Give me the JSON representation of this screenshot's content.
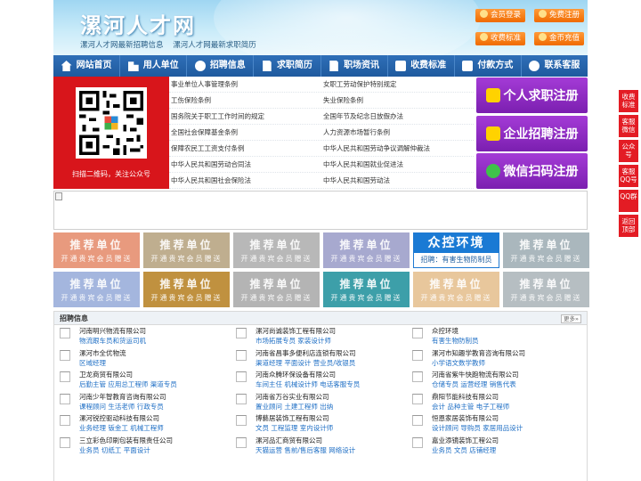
{
  "header": {
    "title": "漯河人才网",
    "slogans": [
      "漯河人才网最新招聘信息",
      "漯河人才网最新求职简历"
    ],
    "buttons": {
      "login": "会员登录",
      "register": "免费注册",
      "fees": "收费标准",
      "coins": "金币充值"
    }
  },
  "nav": [
    {
      "label": "网站首页",
      "icon": "home-icon"
    },
    {
      "label": "用人单位",
      "icon": "building-icon"
    },
    {
      "label": "招聘信息",
      "icon": "user-icon"
    },
    {
      "label": "求职简历",
      "icon": "document-icon"
    },
    {
      "label": "职场资讯",
      "icon": "news-icon"
    },
    {
      "label": "收费标准",
      "icon": "fee-icon"
    },
    {
      "label": "付款方式",
      "icon": "payment-icon"
    },
    {
      "label": "联系客服",
      "icon": "phone-icon"
    }
  ],
  "qr": {
    "caption": "扫描二维码，关注公众号"
  },
  "policies": [
    [
      "事业单位人事管理条例",
      "女职工劳动保护特别规定"
    ],
    [
      "工伤保险条例",
      "失业保险条例"
    ],
    [
      "国务院关于职工工作时间的规定",
      "全国年节及纪念日放假办法"
    ],
    [
      "全国社会保障基金条例",
      "人力资源市场暂行条例"
    ],
    [
      "保障农民工工资支付条例",
      "中华人民共和国劳动争议调解仲裁法"
    ],
    [
      "中华人民共和国劳动合同法",
      "中华人民共和国就业促进法"
    ],
    [
      "中华人民共和国社会保险法",
      "中华人民共和国劳动法"
    ]
  ],
  "register": {
    "job_seeker": "个人求职注册",
    "employer": "企业招聘注册",
    "wechat": "微信扫码注册"
  },
  "recommend": {
    "title": "推荐单位",
    "subtitle": "开通贵宾会员赠送",
    "brand_name": "众控环境",
    "brand_sub": "招聘：有害生物防制员",
    "colors": [
      "#e89a7e",
      "#bfae8f",
      "#b8b8b8",
      "#a7a9cf",
      "#1a7ad4",
      "#aab7bd",
      "#a4b6de",
      "#c0913f",
      "#b4b4b4",
      "#3d9fa9",
      "#e8c79c",
      "#b6bec2"
    ]
  },
  "jobs": {
    "title": "招聘信息",
    "more": "更多»",
    "items": [
      {
        "company": "河南明兴物流有限公司",
        "positions": "物流跟车员和货运司机"
      },
      {
        "company": "漯河尚诚装饰工程有限公司",
        "positions": "市场拓展专员 家装设计师"
      },
      {
        "company": "众控环境",
        "positions": "有害生物防制员"
      },
      {
        "company": "漯河市全优物流",
        "positions": "区域经理"
      },
      {
        "company": "河南省昌事多便利店连锁有限公司",
        "positions": "渠道经理 平面设计 营业员/收银员"
      },
      {
        "company": "漯河市知趣学教育咨询有限公司",
        "positions": "小学语文数学教师"
      },
      {
        "company": "卫龙商贸有限公司",
        "positions": "后勤主管 应用总工程师 渠道专员"
      },
      {
        "company": "河南众腾环保设备有限公司",
        "positions": "车间主任 机械设计师 电话客服专员"
      },
      {
        "company": "河南省紫牛快跑物流有限公司",
        "positions": "仓储专员 运营经理 销售代表"
      },
      {
        "company": "河南少年智教育咨询有限公司",
        "positions": "课程顾问 生活老师 行政专员"
      },
      {
        "company": "河南省万谷实业有限公司",
        "positions": "置业顾问 土建工程师 出纳"
      },
      {
        "company": "鼎阳节能科技有限公司",
        "positions": "会计 品种主管 电子工程师"
      },
      {
        "company": "漯河锐控驱动科技有限公司",
        "positions": "业务经理 钣金工 机械工程师"
      },
      {
        "company": "博藝居装饰工程有限公司",
        "positions": "文员 工程监理 室内设计师"
      },
      {
        "company": "恒恩家居装饰有限公司",
        "positions": "设计顾问 导购员 家居用品设计"
      },
      {
        "company": "三立彩色印刷包装有限责任公司",
        "positions": "业务员 切纸工 平面设计"
      },
      {
        "company": "漯河品汇商贸有限公司",
        "positions": "天猫运营 售前/售后客服 网络设计"
      },
      {
        "company": "嘉业添镜装饰工程公司",
        "positions": "业务员 文员 店铺经理"
      }
    ]
  },
  "float": [
    "收费标准",
    "客服微信",
    "公众号",
    "客服QQ号",
    "QQ群",
    "返回顶部"
  ]
}
